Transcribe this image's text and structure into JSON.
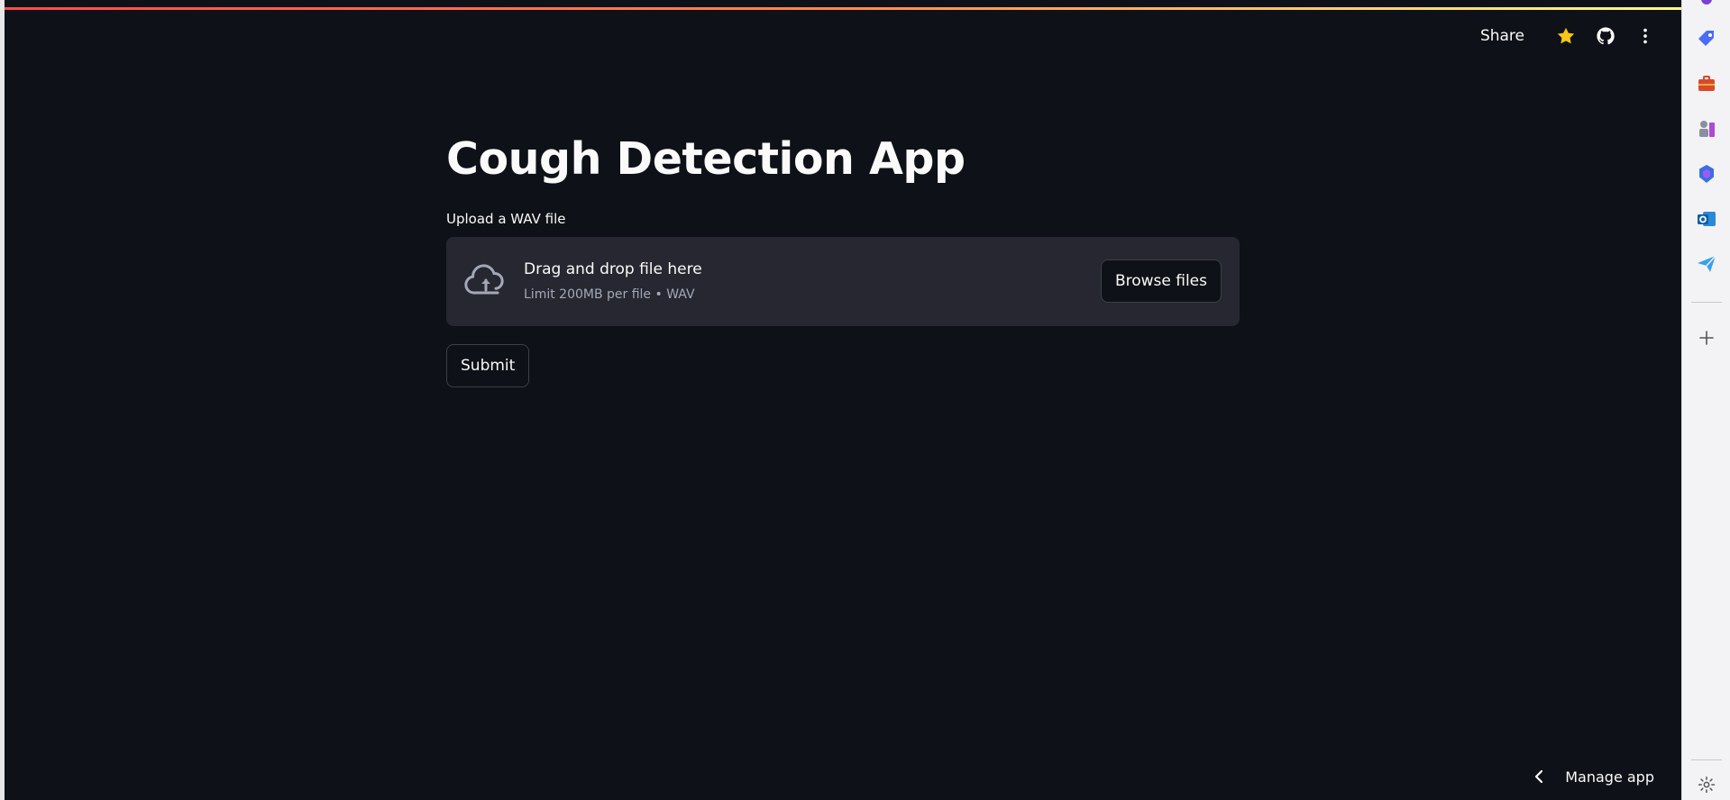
{
  "header": {
    "share_label": "Share",
    "icons": [
      "star-icon",
      "github-icon",
      "more-vertical-icon"
    ]
  },
  "main": {
    "title": "Cough Detection App",
    "upload": {
      "label": "Upload a WAV file",
      "dropzone_title": "Drag and drop file here",
      "dropzone_limit": "Limit 200MB per file • WAV",
      "browse_label": "Browse files"
    },
    "submit_label": "Submit"
  },
  "footer": {
    "manage_label": "Manage app"
  },
  "browser_sidebar": {
    "icons": [
      "tag-icon",
      "briefcase-icon",
      "chess-icon",
      "copilot-icon",
      "outlook-icon",
      "send-icon",
      "add-icon",
      "settings-icon"
    ]
  },
  "colors": {
    "background": "#0e1117",
    "text": "#fafafa",
    "dropzone": "#262730",
    "accent": "#ff4b4b",
    "star": "#f5c518"
  }
}
